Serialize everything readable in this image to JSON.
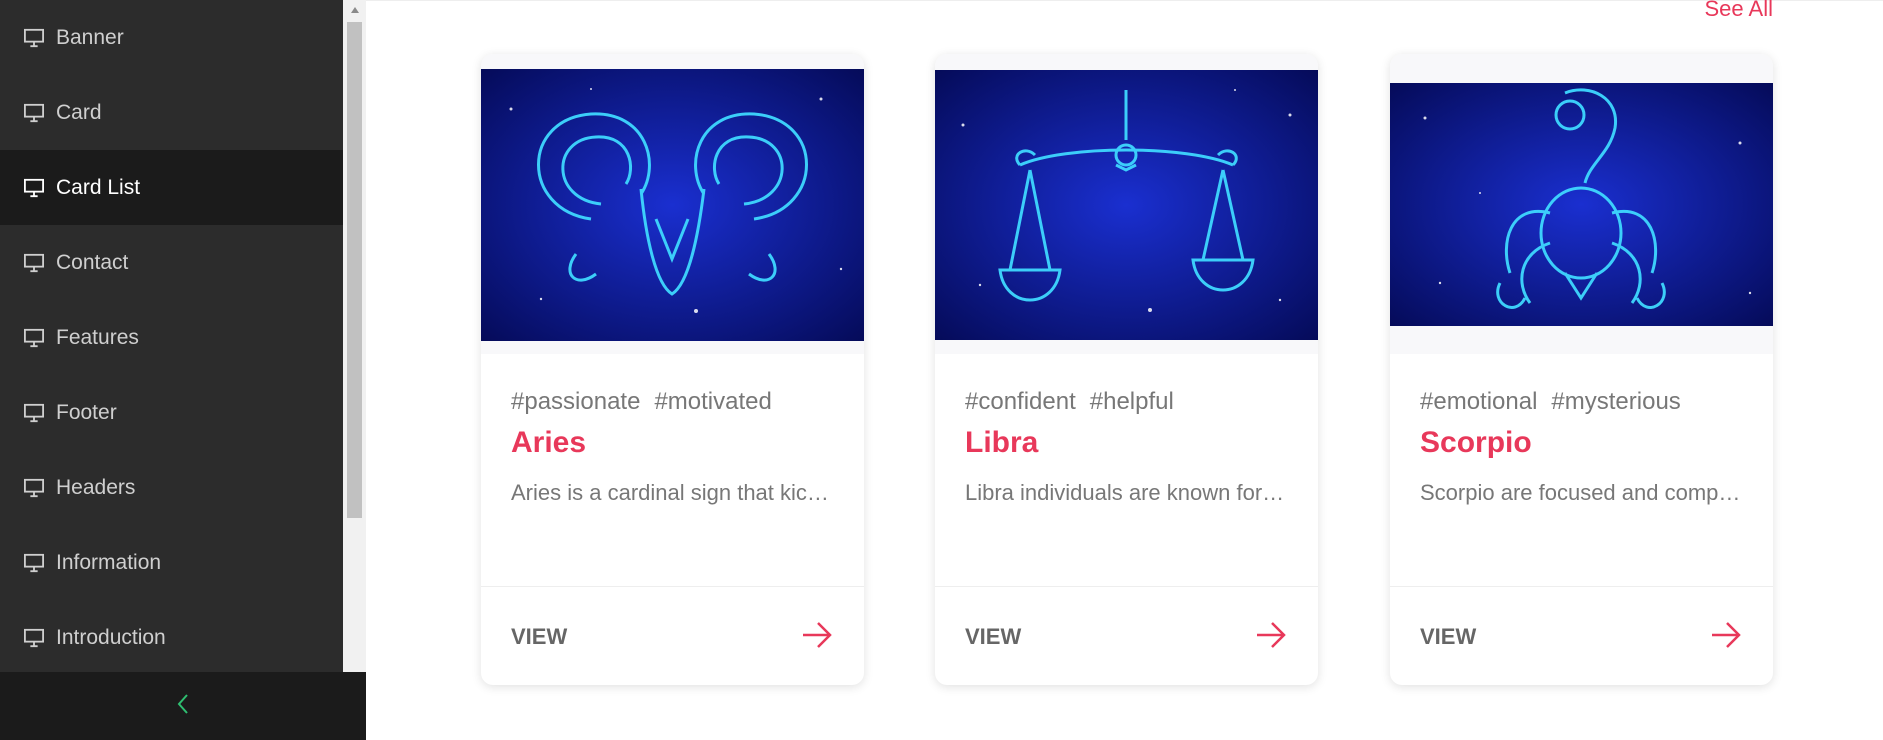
{
  "sidebar": {
    "items": [
      {
        "label": "Banner",
        "icon": "monitor-icon",
        "active": false
      },
      {
        "label": "Card",
        "icon": "monitor-icon",
        "active": false
      },
      {
        "label": "Card List",
        "icon": "monitor-icon",
        "active": true
      },
      {
        "label": "Contact",
        "icon": "monitor-icon",
        "active": false
      },
      {
        "label": "Features",
        "icon": "monitor-icon",
        "active": false
      },
      {
        "label": "Footer",
        "icon": "monitor-icon",
        "active": false
      },
      {
        "label": "Headers",
        "icon": "monitor-icon",
        "active": false
      },
      {
        "label": "Information",
        "icon": "monitor-icon",
        "active": false
      },
      {
        "label": "Introduction",
        "icon": "monitor-icon",
        "active": false
      }
    ],
    "collapse_icon": "chevron-left-icon",
    "collapse_color": "#2fbf71"
  },
  "main": {
    "see_all": "See All",
    "cards": [
      {
        "tags": [
          "#passionate",
          "#motivated"
        ],
        "title": "Aries",
        "description": "Aries is a cardinal sign that kicks off the zodiac",
        "action": "VIEW",
        "image_icon": "aries-ram-image"
      },
      {
        "tags": [
          "#confident",
          "#helpful"
        ],
        "title": "Libra",
        "description": "Libra individuals are known for their balance",
        "action": "VIEW",
        "image_icon": "libra-scales-image"
      },
      {
        "tags": [
          "#emotional",
          "#mysterious"
        ],
        "title": "Scorpio",
        "description": "Scorpio are focused and compelling",
        "action": "VIEW",
        "image_icon": "scorpio-scorpion-image"
      }
    ]
  },
  "colors": {
    "accent": "#e8385a",
    "sidebar_bg": "#2c2c2c",
    "sidebar_active": "#1b1b1b",
    "image_bg": "#0a1a8a",
    "glow": "#3fd8ff"
  }
}
